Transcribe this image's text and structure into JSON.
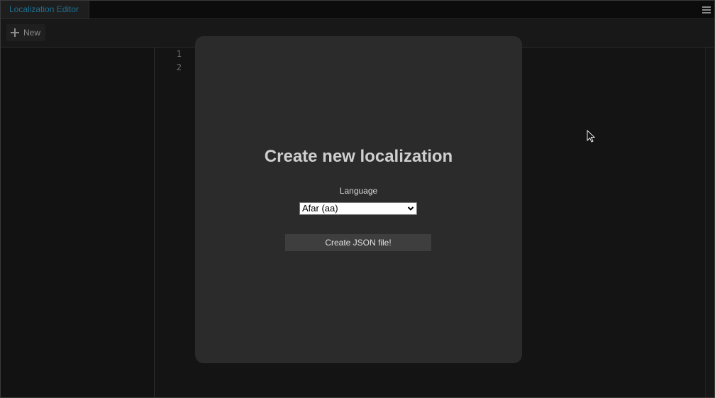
{
  "tabs": [
    {
      "label": "Localization Editor"
    }
  ],
  "toolbar": {
    "new_label": "New"
  },
  "editor": {
    "line_numbers": [
      "1",
      "2"
    ]
  },
  "modal": {
    "title": "Create new localization",
    "language_label": "Language",
    "language_selected": "Afar (aa)",
    "create_button_label": "Create JSON file!"
  },
  "colors": {
    "modal_background": "#2b2b2b",
    "app_background": "#141414",
    "tab_text": "#1e6f8f"
  }
}
